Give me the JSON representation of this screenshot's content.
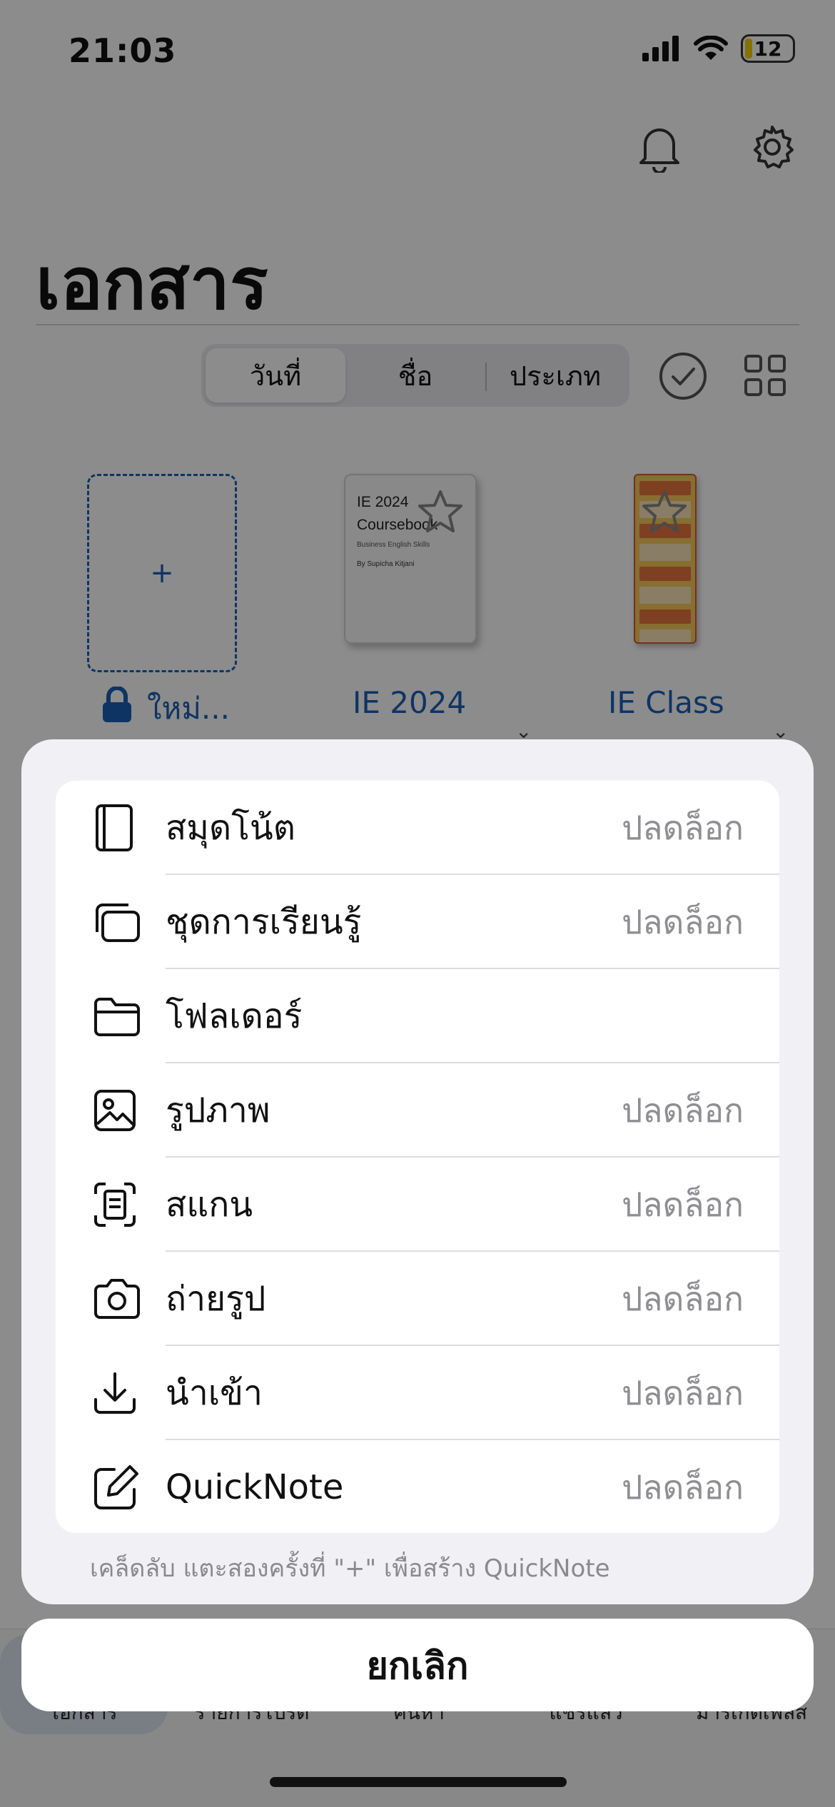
{
  "status_bar": {
    "time": "21:03",
    "battery": "12"
  },
  "page": {
    "title": "เอกสาร"
  },
  "sort_tabs": [
    {
      "label": "วันที่",
      "active": true
    },
    {
      "label": "ชื่อ",
      "active": false
    },
    {
      "label": "ประเภท",
      "active": false
    }
  ],
  "documents": [
    {
      "label": "ใหม่...",
      "type": "new",
      "locked": true,
      "plus": "+"
    },
    {
      "label": "IE 2024",
      "cover_title": "IE 2024 Coursebook",
      "cover_sub": "Business English Skills",
      "cover_author": "By Supicha Kitjani"
    },
    {
      "label": "IE Class"
    }
  ],
  "tabbar": {
    "items": [
      "เอกสาร",
      "รายการโปรด",
      "ค้นหา",
      "แชร์แล้ว",
      "มาร์เก็ตเพลส"
    ]
  },
  "sheet": {
    "items": [
      {
        "label": "สมุดโน้ต",
        "status": "ปลดล็อก",
        "icon": "notebook-icon"
      },
      {
        "label": "ชุดการเรียนรู้",
        "status": "ปลดล็อก",
        "icon": "flashcards-icon"
      },
      {
        "label": "โฟลเดอร์",
        "status": "",
        "icon": "folder-icon"
      },
      {
        "label": "รูปภาพ",
        "status": "ปลดล็อก",
        "icon": "image-icon"
      },
      {
        "label": "สแกน",
        "status": "ปลดล็อก",
        "icon": "scan-icon"
      },
      {
        "label": "ถ่ายรูป",
        "status": "ปลดล็อก",
        "icon": "camera-icon"
      },
      {
        "label": "นำเข้า",
        "status": "ปลดล็อก",
        "icon": "import-icon"
      },
      {
        "label": "QuickNote",
        "status": "ปลดล็อก",
        "icon": "quicknote-icon"
      }
    ],
    "hint": "เคล็ดลับ แตะสองครั้งที่ \"+\" เพื่อสร้าง QuickNote",
    "cancel_label": "ยกเลิก"
  }
}
